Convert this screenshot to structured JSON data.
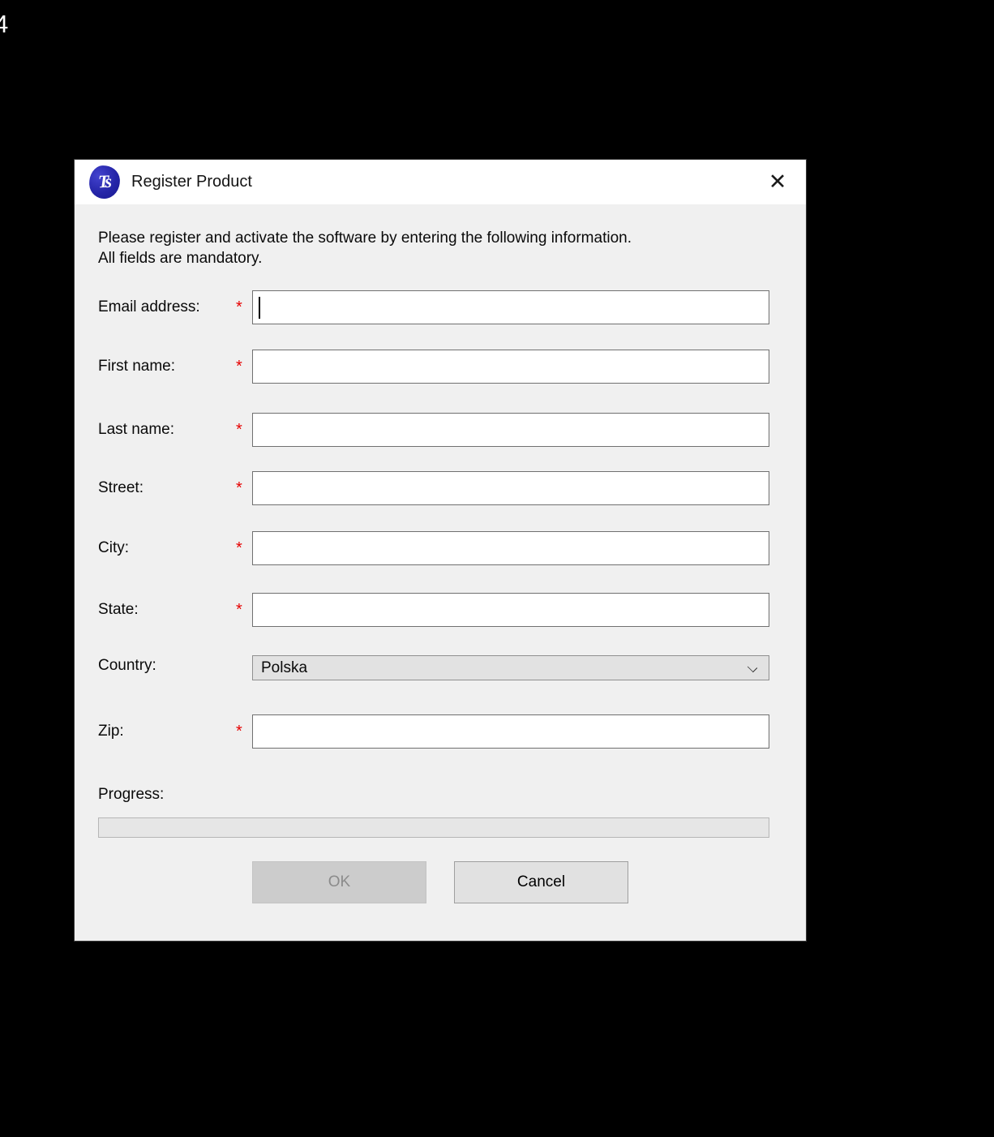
{
  "screen": {
    "background_color": "#000000",
    "stray_text": "4"
  },
  "dialog": {
    "title": "Register Product",
    "app_icon_text": "Ts",
    "app_icon_color": "#2525a8",
    "close_icon": "✕",
    "instructions_line1": "Please register and activate the software by entering the following information.",
    "instructions_line2": "All fields are mandatory.",
    "required_mark": "*",
    "required_mark_color": "#e60000",
    "fields": [
      {
        "label": "Email address:",
        "required": true,
        "type": "text",
        "value": "",
        "focused": true
      },
      {
        "label": "First name:",
        "required": true,
        "type": "text",
        "value": "",
        "focused": false
      },
      {
        "label": "Last name:",
        "required": true,
        "type": "text",
        "value": "",
        "focused": false
      },
      {
        "label": "Street:",
        "required": true,
        "type": "text",
        "value": "",
        "focused": false
      },
      {
        "label": "City:",
        "required": true,
        "type": "text",
        "value": "",
        "focused": false
      },
      {
        "label": "State:",
        "required": true,
        "type": "text",
        "value": "",
        "focused": false
      },
      {
        "label": "Country:",
        "required": false,
        "type": "select",
        "value": "Polska",
        "focused": false
      },
      {
        "label": "Zip:",
        "required": true,
        "type": "text",
        "value": "",
        "focused": false
      }
    ],
    "progress": {
      "label": "Progress:",
      "percent": 0
    },
    "buttons": {
      "ok_label": "OK",
      "ok_enabled": false,
      "cancel_label": "Cancel",
      "cancel_enabled": true
    }
  }
}
